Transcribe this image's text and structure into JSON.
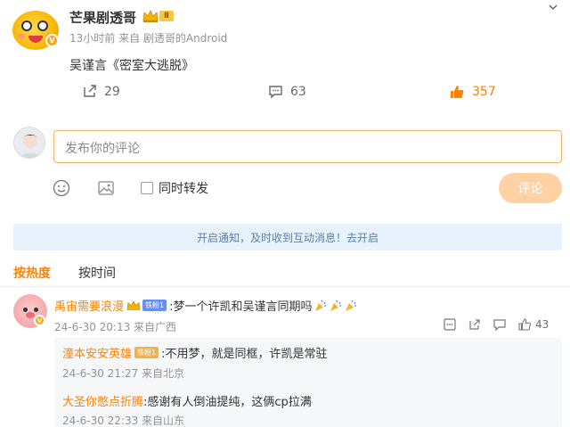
{
  "post": {
    "username": "芒果剧透哥",
    "meta": "13小时前  来自 剧透哥的Android",
    "text": "吴谨言《密室大逃脱》",
    "repost_count": "29",
    "comment_count": "63",
    "like_count": "357"
  },
  "composer": {
    "placeholder": "发布你的评论",
    "repost_label": "同时转发",
    "submit_label": "评论"
  },
  "notification": {
    "text": "开启通知，及时收到互动消息！去开启"
  },
  "sort_tabs": {
    "hot": "按热度",
    "time": "按时间"
  },
  "comment": {
    "username": "禹宙需要浪漫",
    "fan_badge": "铁粉1",
    "text": ":梦一个许凯和吴谨言同期吗",
    "meta": "24-6-30 20:13  来自广西",
    "like_count": "43",
    "replies": [
      {
        "username": "潼本安安英雄",
        "fan_badge": "铁粉1",
        "text": ":不用梦，就是同框，许凯是常驻",
        "meta": "24-6-30 21:27  来自北京"
      },
      {
        "username": "大圣你憋点折腾",
        "text": ":感谢有人倒油提纯，这俩cp拉满",
        "meta": "24-6-30 22:33  来自山东"
      }
    ]
  },
  "colors": {
    "accent": "#ff8200",
    "link_blue": "#5b7fa6",
    "notify_bg": "#e8f2fc",
    "submit_disabled": "#ffd2a6"
  },
  "icons": [
    "chevron-down-icon",
    "crown-icon",
    "repost-icon",
    "comment-icon",
    "like-icon",
    "emoji-icon",
    "image-icon",
    "share-icon",
    "more-icon",
    "party-popper-icon",
    "verified-badge-icon"
  ]
}
